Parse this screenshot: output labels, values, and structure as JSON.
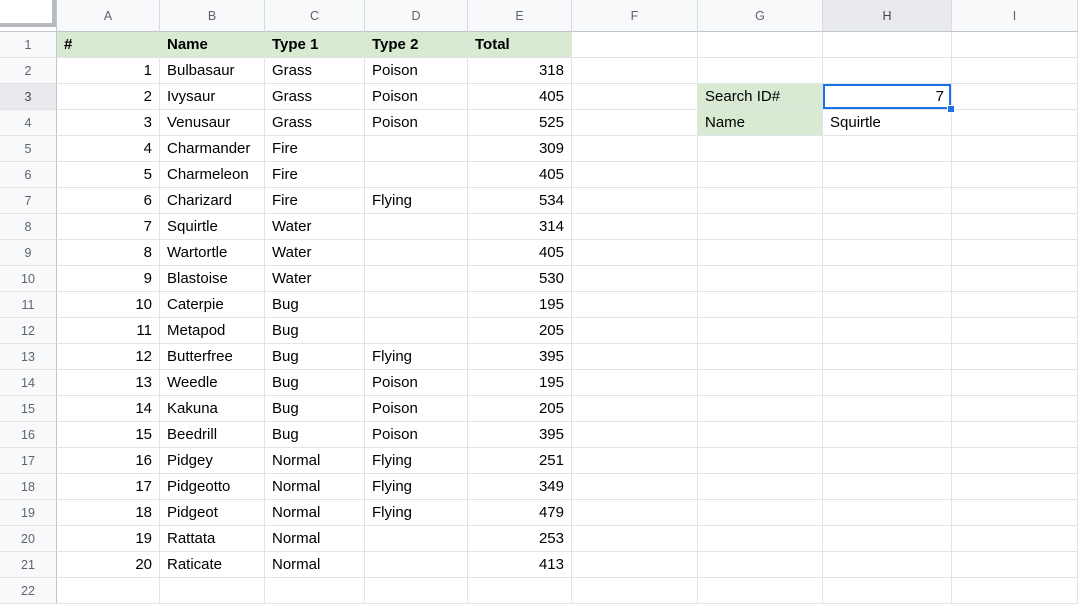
{
  "sheet": {
    "column_headers": [
      "A",
      "B",
      "C",
      "D",
      "E",
      "F",
      "G",
      "H",
      "I"
    ],
    "row_count": 22,
    "selection": {
      "cell": "H3",
      "column": "H",
      "row": 3
    },
    "table": {
      "header_row": [
        "#",
        "Name",
        "Type 1",
        "Type 2",
        "Total"
      ],
      "rows": [
        [
          "1",
          "Bulbasaur",
          "Grass",
          "Poison",
          "318"
        ],
        [
          "2",
          "Ivysaur",
          "Grass",
          "Poison",
          "405"
        ],
        [
          "3",
          "Venusaur",
          "Grass",
          "Poison",
          "525"
        ],
        [
          "4",
          "Charmander",
          "Fire",
          "",
          "309"
        ],
        [
          "5",
          "Charmeleon",
          "Fire",
          "",
          "405"
        ],
        [
          "6",
          "Charizard",
          "Fire",
          "Flying",
          "534"
        ],
        [
          "7",
          "Squirtle",
          "Water",
          "",
          "314"
        ],
        [
          "8",
          "Wartortle",
          "Water",
          "",
          "405"
        ],
        [
          "9",
          "Blastoise",
          "Water",
          "",
          "530"
        ],
        [
          "10",
          "Caterpie",
          "Bug",
          "",
          "195"
        ],
        [
          "11",
          "Metapod",
          "Bug",
          "",
          "205"
        ],
        [
          "12",
          "Butterfree",
          "Bug",
          "Flying",
          "395"
        ],
        [
          "13",
          "Weedle",
          "Bug",
          "Poison",
          "195"
        ],
        [
          "14",
          "Kakuna",
          "Bug",
          "Poison",
          "205"
        ],
        [
          "15",
          "Beedrill",
          "Bug",
          "Poison",
          "395"
        ],
        [
          "16",
          "Pidgey",
          "Normal",
          "Flying",
          "251"
        ],
        [
          "17",
          "Pidgeotto",
          "Normal",
          "Flying",
          "349"
        ],
        [
          "18",
          "Pidgeot",
          "Normal",
          "Flying",
          "479"
        ],
        [
          "19",
          "Rattata",
          "Normal",
          "",
          "253"
        ],
        [
          "20",
          "Raticate",
          "Normal",
          "",
          "413"
        ]
      ]
    },
    "lookup": {
      "search_label": "Search ID#",
      "search_value": "7",
      "name_label": "Name",
      "name_value": "Squirtle"
    },
    "colors": {
      "highlight_green": "#d9ead3",
      "selection_blue": "#1a73e8",
      "header_bg": "#f8f9fa",
      "active_header_bg": "#e8eaed"
    }
  }
}
